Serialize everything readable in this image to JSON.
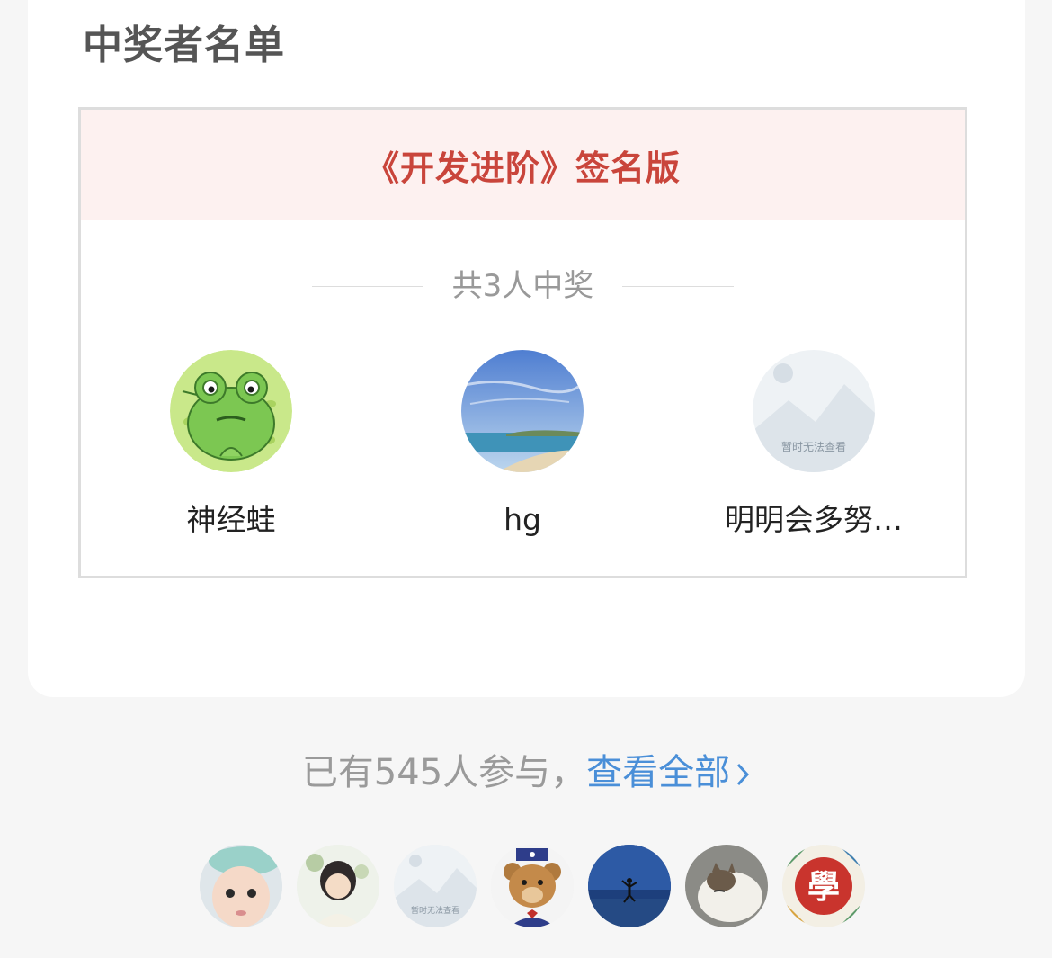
{
  "section": {
    "title": "中奖者名单"
  },
  "prize": {
    "name": "《开发进阶》签名版",
    "winner_count_text": "共3人中奖",
    "winners": [
      {
        "name": "神经蛙",
        "avatar": "frog-avatar"
      },
      {
        "name": "hg",
        "avatar": "beach-avatar"
      },
      {
        "name": "明明会多努…",
        "avatar": "placeholder-avatar",
        "placeholder_text": "暂时无法查看"
      }
    ]
  },
  "participation": {
    "count_text": "已有545人参与，",
    "view_all_label": "查看全部",
    "participants": [
      {
        "avatar": "baby-avatar"
      },
      {
        "avatar": "illustration-avatar"
      },
      {
        "avatar": "placeholder-avatar",
        "placeholder_text": "暂时无法查看"
      },
      {
        "avatar": "bear-avatar"
      },
      {
        "avatar": "jumping-person-avatar"
      },
      {
        "avatar": "cat-avatar"
      },
      {
        "avatar": "xue-character-avatar",
        "glyph": "學"
      }
    ]
  },
  "colors": {
    "prize_title": "#c9453b",
    "prize_header_bg": "#fdf1f0",
    "link": "#4a8fd8",
    "muted": "#999999"
  }
}
